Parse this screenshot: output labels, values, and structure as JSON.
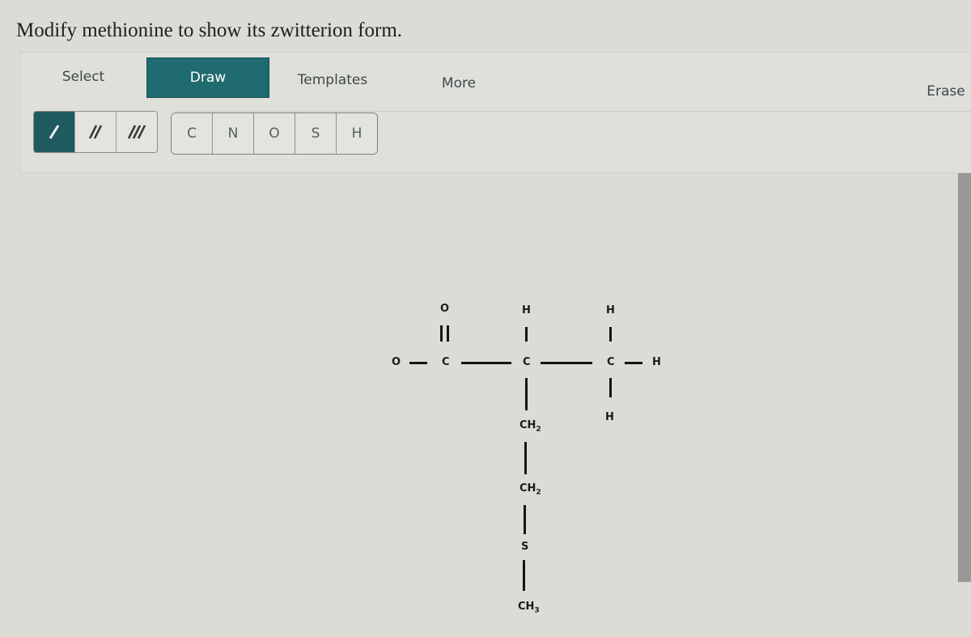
{
  "prompt": "Modify methionine to show its zwitterion form.",
  "toolbar": {
    "tabs": {
      "select": "Select",
      "draw": "Draw",
      "templates": "Templates",
      "more": "More",
      "erase": "Erase"
    },
    "active_tab": "Draw",
    "bond_tools": [
      "single-bond",
      "double-bond",
      "triple-bond"
    ],
    "active_bond": "single-bond",
    "atoms": [
      "C",
      "N",
      "O",
      "S",
      "H"
    ]
  },
  "colors": {
    "accent": "#1f6b6f"
  },
  "molecule": {
    "name": "methionine",
    "atoms": {
      "o_single": "O",
      "o_double": "O",
      "c_carboxyl": "C",
      "h_alpha": "H",
      "c_alpha": "C",
      "h_top_right": "H",
      "c_right": "C",
      "h_right": "H",
      "h_bottom_right": "H",
      "ch2_1": "CH",
      "ch2_1_sub": "2",
      "ch2_2": "CH",
      "ch2_2_sub": "2",
      "s": "S",
      "ch3": "CH",
      "ch3_sub": "3"
    }
  }
}
